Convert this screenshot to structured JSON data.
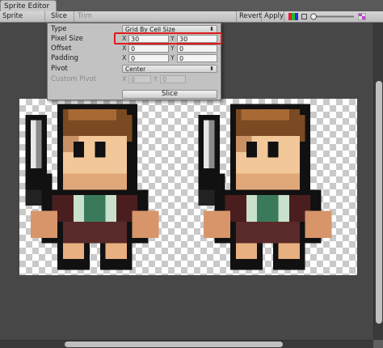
{
  "window": {
    "title": "Sprite Editor"
  },
  "toolbar": {
    "editor_mode": "Sprite Editor",
    "slice_menu": "Slice",
    "trim": "Trim",
    "revert": "Revert",
    "apply": "Apply",
    "icons": [
      "color-channel-icon",
      "zoom-small-icon",
      "zoom-slider",
      "zoom-large-icon"
    ]
  },
  "slice_panel": {
    "type": {
      "label": "Type",
      "value": "Grid By Cell Size"
    },
    "pixel_size": {
      "label": "Pixel Size",
      "x_label": "X",
      "x": "30",
      "y_label": "Y",
      "y": "30"
    },
    "offset": {
      "label": "Offset",
      "x_label": "X",
      "x": "0",
      "y_label": "Y",
      "y": "0"
    },
    "padding": {
      "label": "Padding",
      "x_label": "X",
      "x": "0",
      "y_label": "Y",
      "y": "0"
    },
    "pivot": {
      "label": "Pivot",
      "value": "Center"
    },
    "custom_pivot": {
      "label": "Custom Pivot",
      "x_label": "X",
      "x": "0",
      "y_label": "Y",
      "y": "0"
    },
    "slice_button": "Slice"
  },
  "colors": {
    "highlight": "#e01a1a",
    "canvas": "#474747"
  }
}
